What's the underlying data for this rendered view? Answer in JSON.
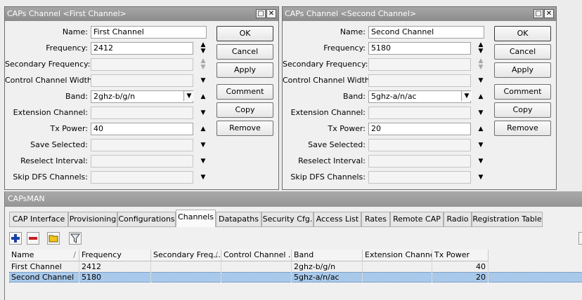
{
  "windows": [
    {
      "title": "CAPs Channel <First Channel>",
      "fields": {
        "name": "First Channel",
        "frequency": "2412",
        "secondary_frequency": "",
        "control_channel_width": "",
        "band": "2ghz-b/g/n",
        "extension_channel": "",
        "tx_power": "40",
        "save_selected": "",
        "reselect_interval": "",
        "skip_dfs_channels": ""
      }
    },
    {
      "title": "CAPs Channel <Second Channel>",
      "fields": {
        "name": "Second Channel",
        "frequency": "5180",
        "secondary_frequency": "",
        "control_channel_width": "",
        "band": "5ghz-a/n/ac",
        "extension_channel": "",
        "tx_power": "20",
        "save_selected": "",
        "reselect_interval": "",
        "skip_dfs_channels": ""
      }
    }
  ],
  "labels": {
    "name": "Name:",
    "frequency": "Frequency:",
    "secondary_frequency": "Secondary Frequency:",
    "control_channel_width": "Control Channel Width:",
    "band": "Band:",
    "extension_channel": "Extension Channel:",
    "tx_power": "Tx Power:",
    "save_selected": "Save Selected:",
    "reselect_interval": "Reselect Interval:",
    "skip_dfs_channels": "Skip DFS Channels:"
  },
  "buttons": {
    "ok": "OK",
    "cancel": "Cancel",
    "apply": "Apply",
    "comment": "Comment",
    "copy": "Copy",
    "remove": "Remove"
  },
  "capsman": {
    "title": "CAPsMAN",
    "tabs": [
      "CAP Interface",
      "Provisioning",
      "Configurations",
      "Channels",
      "Datapaths",
      "Security Cfg.",
      "Access List",
      "Rates",
      "Remote CAP",
      "Radio",
      "Registration Table"
    ],
    "active_tab": "Channels",
    "columns": [
      "Name",
      "Frequency",
      "Secondary Freq...",
      "Control Channel ...",
      "Band",
      "Extension Channel",
      "Tx Power"
    ],
    "rows": [
      [
        "First Channel",
        "2412",
        "",
        "",
        "2ghz-b/g/n",
        "",
        "40"
      ],
      [
        "Second Channel",
        "5180",
        "",
        "",
        "5ghz-a/n/ac",
        "",
        "20"
      ]
    ],
    "selected_row": 1
  },
  "colors": {
    "titlebar": "#9a9a9a",
    "selection": "#a9c9ea",
    "add_icon": "#1a3fa8",
    "remove_icon": "#c81e1e",
    "folder_icon": "#f0c419"
  }
}
